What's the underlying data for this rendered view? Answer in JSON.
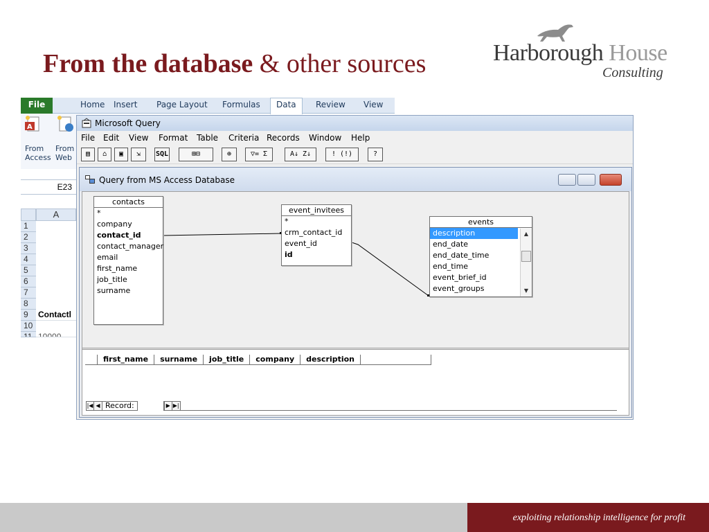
{
  "slide": {
    "title_bold": "From the database",
    "title_rest": "& other sources",
    "logo": {
      "name_dark": "Harborough",
      "name_light": "House",
      "sub": "Consulting"
    },
    "tagline": "exploiting relationship intelligence for profit"
  },
  "excel": {
    "tabs": [
      "File",
      "Home",
      "Insert",
      "Page Layout",
      "Formulas",
      "Data",
      "Review",
      "View"
    ],
    "active_tab": "Data",
    "ribbon_buttons": [
      {
        "line1": "From",
        "line2": "Access"
      },
      {
        "line1": "From",
        "line2": "Web"
      }
    ],
    "name_box": "E23",
    "column": "A",
    "rows": [
      "1",
      "2",
      "3",
      "4",
      "5",
      "6",
      "7",
      "8",
      "9",
      "10",
      "11"
    ],
    "row9_value": "Contactl",
    "row11_value": "10000"
  },
  "msquery": {
    "app_title": "Microsoft Query",
    "menu": [
      "File",
      "Edit",
      "View",
      "Format",
      "Table",
      "Criteria",
      "Records",
      "Window",
      "Help"
    ],
    "toolbar": [
      "new",
      "open",
      "save",
      "return-data",
      "SQL",
      "show-tables",
      "show-criteria",
      "add-tables",
      "criteria-equals",
      "totals",
      "sort-asc",
      "sort-desc",
      "query-now",
      "auto-query",
      "help"
    ],
    "query_window_title": "Query from MS Access Database",
    "tables": [
      {
        "name": "contacts",
        "fields": [
          "*",
          "company",
          "contact_id",
          "contact_manager",
          "email",
          "first_name",
          "job_title",
          "surname"
        ],
        "bold": [
          "contact_id"
        ]
      },
      {
        "name": "event_invitees",
        "fields": [
          "*",
          "crm_contact_id",
          "event_id",
          "id"
        ],
        "bold": [
          "id"
        ]
      },
      {
        "name": "events",
        "fields": [
          "description",
          "end_date",
          "end_date_time",
          "end_time",
          "event_brief_id",
          "event_groups"
        ],
        "selected": "description"
      }
    ],
    "result_columns": [
      "first_name",
      "surname",
      "job_title",
      "company",
      "description"
    ],
    "record_label": "Record:"
  }
}
